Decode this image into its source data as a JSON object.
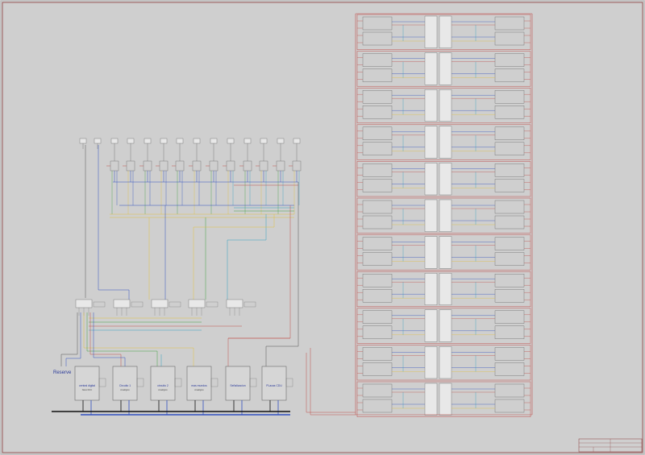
{
  "diagram": {
    "reserve_label": "Reserve",
    "modules": [
      {
        "title": "central digital",
        "subtitle": "Nano DCC"
      },
      {
        "title": "Circuito 1",
        "subtitle": "Analógico"
      },
      {
        "title": "circuito 2",
        "subtitle": "Analógico"
      },
      {
        "title": "mas mundos",
        "subtitle": "Analógico"
      },
      {
        "title": "Señalizacion",
        "subtitle": ""
      },
      {
        "title": "PLacas CDU",
        "subtitle": ""
      }
    ],
    "rack_count": 11,
    "switch_count": 14,
    "relay_count": 5
  },
  "colors": {
    "background": "#cfcfcf",
    "frame": "#8a3a3a",
    "wire_red": "#c0504d",
    "wire_blue": "#3050c0",
    "wire_yellow": "#e0c040",
    "wire_cyan": "#30a0c0",
    "wire_green": "#40a040",
    "wire_black": "#111111",
    "component_outline": "#6a6a6a",
    "text_blue": "#2a3a9a"
  }
}
